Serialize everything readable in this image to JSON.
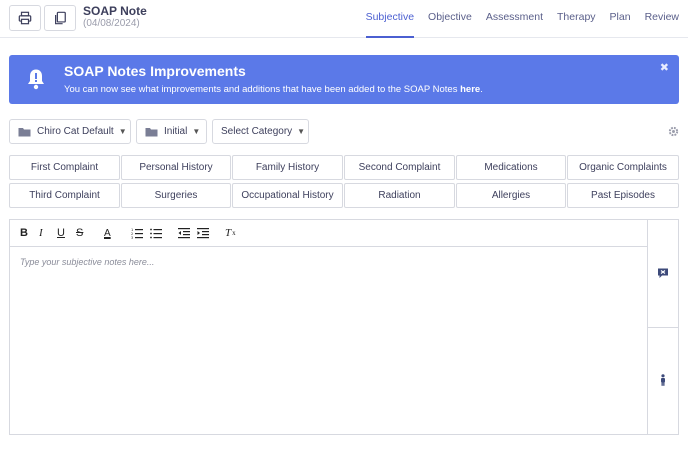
{
  "header": {
    "title": "SOAP Note",
    "date": "(04/08/2024)",
    "tabs": [
      "Subjective",
      "Objective",
      "Assessment",
      "Therapy",
      "Plan",
      "Review"
    ],
    "active_tab": "Subjective"
  },
  "banner": {
    "title": "SOAP Notes Improvements",
    "text": "You can now see what improvements and additions that have been added to the SOAP Notes ",
    "link": "here",
    "suffix": ".",
    "close": "✖"
  },
  "filters": {
    "template": "Chiro Cat Default",
    "visit_type": "Initial",
    "category": "Select Category"
  },
  "categories": [
    "First Complaint",
    "Personal History",
    "Family History",
    "Second Complaint",
    "Medications",
    "Organic Complaints",
    "Third Complaint",
    "Surgeries",
    "Occupational History",
    "Radiation",
    "Allergies",
    "Past Episodes"
  ],
  "editor": {
    "placeholder": "Type your subjective notes here...",
    "toolbar": {
      "bold": "B",
      "italic": "I",
      "underline": "U",
      "strike": "S",
      "font_color": "A",
      "clear": "T"
    }
  },
  "colors": {
    "accent": "#4b5fd1",
    "banner": "#5b79e8",
    "border": "#d7d9e0"
  }
}
